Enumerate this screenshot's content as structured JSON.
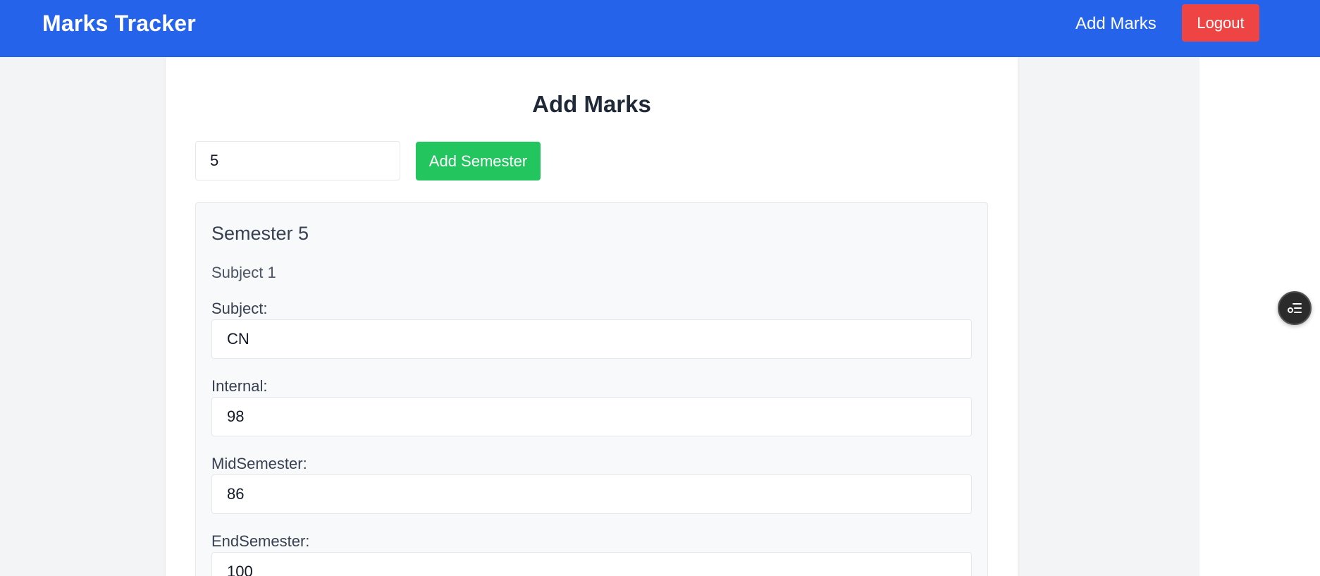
{
  "navbar": {
    "brand": "Marks Tracker",
    "add_marks_link": "Add Marks",
    "logout_label": "Logout"
  },
  "page": {
    "title": "Add Marks",
    "semester_input_value": "5",
    "add_semester_label": "Add Semester"
  },
  "semester": {
    "title": "Semester 5",
    "subject_heading": "Subject 1",
    "fields": [
      {
        "label": "Subject:",
        "value": "CN"
      },
      {
        "label": "Internal:",
        "value": "98"
      },
      {
        "label": "MidSemester:",
        "value": "86"
      },
      {
        "label": "EndSemester:",
        "value": "100"
      }
    ]
  },
  "floating": {
    "icon": "list-settings-icon"
  },
  "colors": {
    "navbar": "#2563eb",
    "logout": "#ef4444",
    "add_semester": "#22c55e",
    "background": "#f3f4f6"
  }
}
